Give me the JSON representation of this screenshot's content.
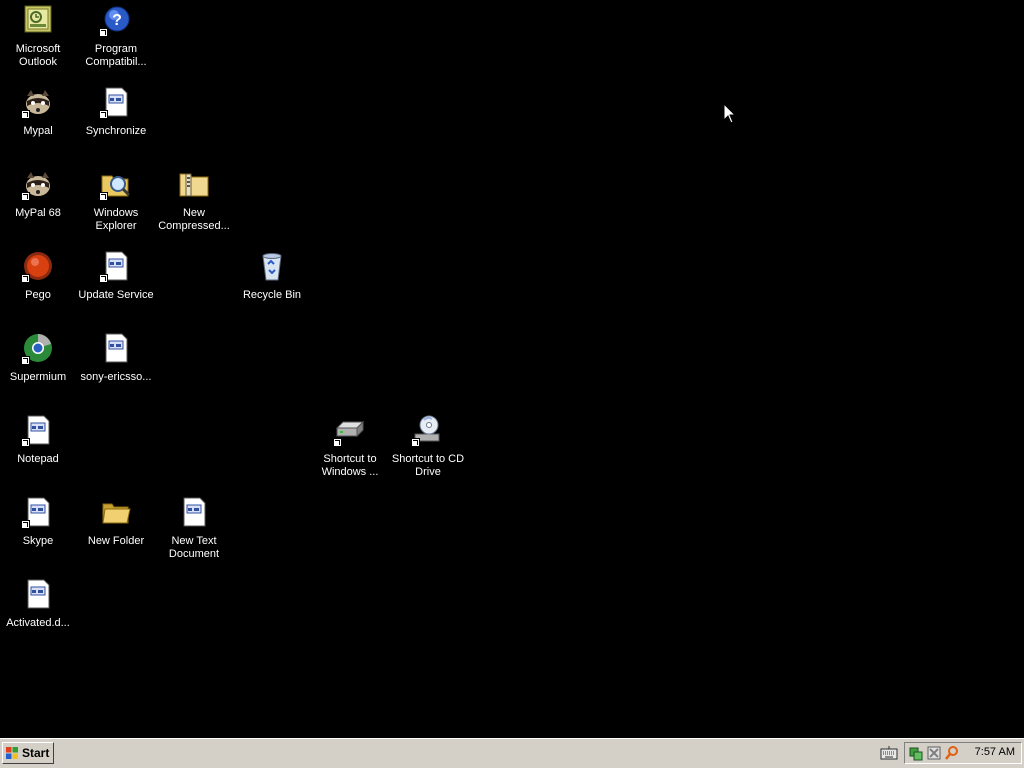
{
  "desktop": {
    "icons": [
      {
        "id": "microsoft-outlook",
        "label": "Microsoft\nOutlook"
      },
      {
        "id": "program-compatibility",
        "label": "Program\nCompatibil..."
      },
      {
        "id": "mypal",
        "label": "Mypal"
      },
      {
        "id": "synchronize",
        "label": "Synchronize"
      },
      {
        "id": "mypal-68",
        "label": "MyPal 68"
      },
      {
        "id": "windows-explorer",
        "label": "Windows\nExplorer"
      },
      {
        "id": "new-compressed",
        "label": "New\nCompressed..."
      },
      {
        "id": "pego",
        "label": "Pego"
      },
      {
        "id": "update-service",
        "label": "Update Service"
      },
      {
        "id": "recycle-bin",
        "label": "Recycle Bin"
      },
      {
        "id": "supermium",
        "label": "Supermium"
      },
      {
        "id": "sony-ericsson",
        "label": "sony-ericsso..."
      },
      {
        "id": "notepad",
        "label": "Notepad"
      },
      {
        "id": "shortcut-windows",
        "label": "Shortcut to\nWindows ..."
      },
      {
        "id": "shortcut-cd-drive",
        "label": "Shortcut to CD\nDrive"
      },
      {
        "id": "skype",
        "label": "Skype"
      },
      {
        "id": "new-folder",
        "label": "New Folder"
      },
      {
        "id": "new-text-document",
        "label": "New Text\nDocument"
      },
      {
        "id": "activated",
        "label": "Activated.d..."
      }
    ]
  },
  "taskbar": {
    "start_label": "Start",
    "clock": "7:57 AM",
    "tray_icons": [
      "network-icon",
      "antivirus-icon",
      "search-icon"
    ]
  },
  "colors": {
    "desktop_background": "#000000",
    "taskbar": "#d4d0c8",
    "label_text": "#ffffff"
  }
}
